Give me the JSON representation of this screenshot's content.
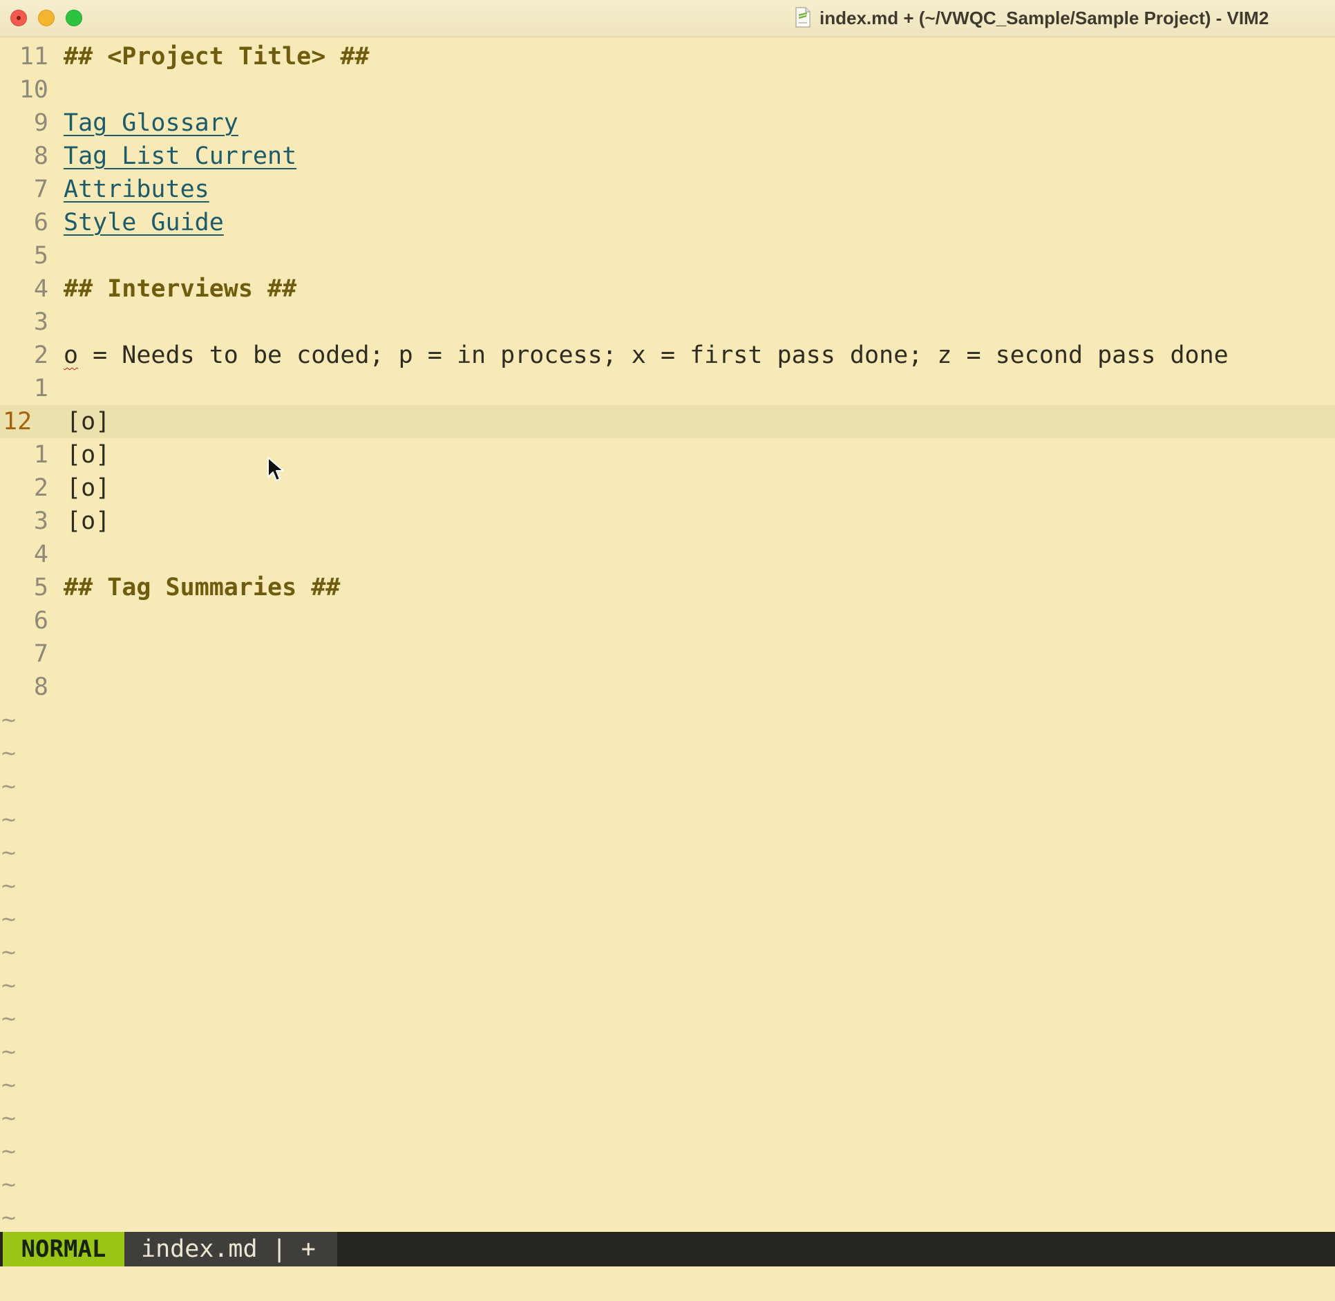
{
  "window": {
    "title": "index.md + (~/VWQC_Sample/Sample Project) - VIM2"
  },
  "editor": {
    "lines": [
      {
        "num": "11",
        "text": "## <Project Title> ##",
        "kind": "heading"
      },
      {
        "num": "10",
        "text": "",
        "kind": "blank"
      },
      {
        "num": "9",
        "text": "Tag Glossary",
        "kind": "link"
      },
      {
        "num": "8",
        "text": "Tag List Current",
        "kind": "link"
      },
      {
        "num": "7",
        "text": "Attributes",
        "kind": "link"
      },
      {
        "num": "6",
        "text": "Style Guide",
        "kind": "link"
      },
      {
        "num": "5",
        "text": "",
        "kind": "blank"
      },
      {
        "num": "4",
        "text": "## Interviews ##",
        "kind": "heading"
      },
      {
        "num": "3",
        "text": "",
        "kind": "blank"
      },
      {
        "num": "2",
        "text_first": "o",
        "text_rest": " = Needs to be coded; p = in process; x = first pass done; z = second pass done",
        "kind": "legend"
      },
      {
        "num": "1",
        "text": "",
        "kind": "blank"
      },
      {
        "num": "12",
        "text": "[o]",
        "kind": "current"
      },
      {
        "num": "1",
        "text": "[o]",
        "kind": "list"
      },
      {
        "num": "2",
        "text": "[o]",
        "kind": "list"
      },
      {
        "num": "3",
        "text": "[o]",
        "kind": "list"
      },
      {
        "num": "4",
        "text": "",
        "kind": "blank"
      },
      {
        "num": "5",
        "text": "## Tag Summaries ##",
        "kind": "heading"
      },
      {
        "num": "6",
        "text": "",
        "kind": "blank"
      },
      {
        "num": "7",
        "text": "",
        "kind": "blank"
      },
      {
        "num": "8",
        "text": "",
        "kind": "blank"
      }
    ],
    "tilde": "~"
  },
  "statusline": {
    "mode": "NORMAL",
    "buffer": "index.md | +"
  },
  "colors": {
    "background": "#f7eab6",
    "heading": "#6e5c0f",
    "link": "#1d5a6a",
    "mode_bg": "#9ac416",
    "statusline_bg": "#26241f"
  }
}
